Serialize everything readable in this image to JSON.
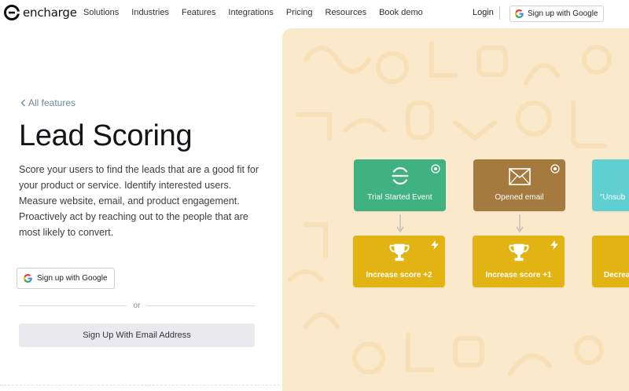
{
  "brand": {
    "name": "encharge"
  },
  "nav": {
    "items": [
      "Solutions",
      "Industries",
      "Features",
      "Integrations",
      "Pricing",
      "Resources",
      "Book demo"
    ],
    "login": "Login",
    "google_signup": "Sign up with Google"
  },
  "hero": {
    "back_link": "All features",
    "title": "Lead Scoring",
    "description": "Score your users to find the leads that are a good fit for your product or service. Identify interested users. Measure website, email, and product engagement. Proactively act by reaching out to the people that are most likely to convert.",
    "google_signup": "Sign up with Google",
    "or": "or",
    "email_signup": "Sign Up With Email Address"
  },
  "flow": {
    "triggers": [
      {
        "label": "Trial Started Event",
        "color": "#3fb27f",
        "icon": "encharge-logo-icon"
      },
      {
        "label": "Opened email",
        "color": "#a57a3f",
        "icon": "envelope-icon"
      },
      {
        "label": "“Unsub",
        "color": "#5fcfd1",
        "icon": "unsubscribe-icon"
      }
    ],
    "actions": [
      {
        "label": "Increase score +2",
        "color": "#e1b413",
        "icon": "trophy-icon"
      },
      {
        "label": "Increase score +1",
        "color": "#e1b413",
        "icon": "trophy-icon"
      },
      {
        "label": "Decrea",
        "color": "#e1b413",
        "icon": "trophy-icon"
      }
    ],
    "trigger_corner_icon": "target-icon",
    "action_corner_icon": "lightning-icon"
  },
  "colors": {
    "panel_bg": "#fbe9cc",
    "back_link": "#6a8799",
    "email_button_bg": "#e9e9ee"
  }
}
